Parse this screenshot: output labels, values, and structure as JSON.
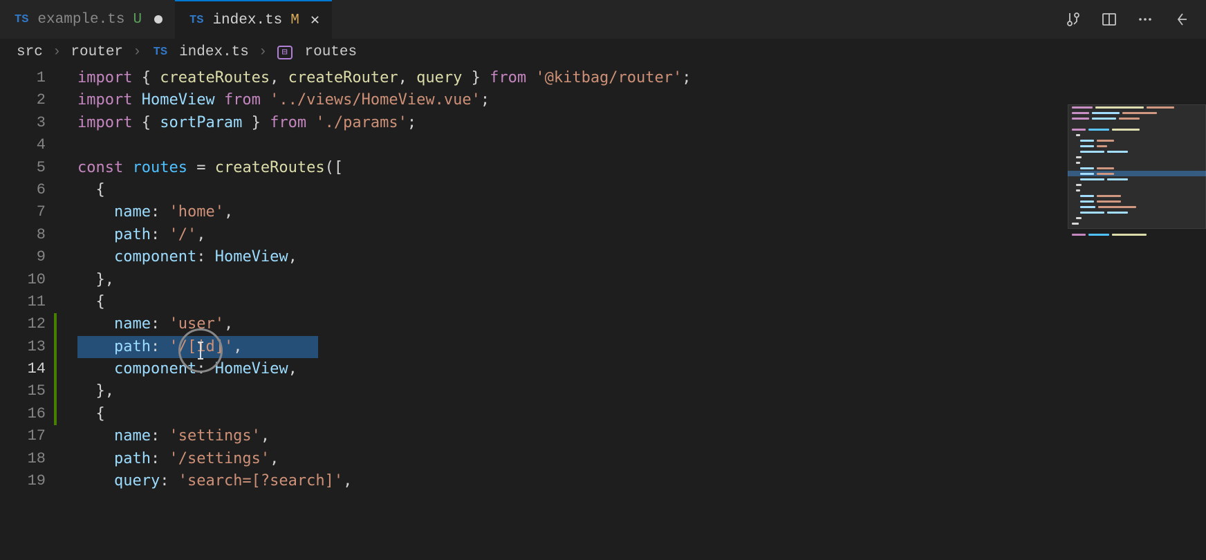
{
  "tabs": [
    {
      "icon": "TS",
      "name": "example.ts",
      "status": "U",
      "dirty": true,
      "active": false
    },
    {
      "icon": "TS",
      "name": "index.ts",
      "status": "M",
      "dirty": false,
      "active": true
    }
  ],
  "breadcrumb": {
    "parts": [
      "src",
      "router"
    ],
    "file_icon": "TS",
    "file": "index.ts",
    "symbol": "routes"
  },
  "lines": [
    "1",
    "2",
    "3",
    "4",
    "5",
    "6",
    "7",
    "8",
    "9",
    "10",
    "11",
    "12",
    "13",
    "14",
    "15",
    "16",
    "17",
    "18",
    "19"
  ],
  "active_line": "14",
  "code": {
    "l1": {
      "t": "import ",
      "a": "{ ",
      "b": "createRoutes",
      "c": ", ",
      "d": "createRouter",
      "e": ", ",
      "f": "query",
      "g": " } ",
      "h": "from ",
      "i": "'@kitbag/router'",
      "j": ";"
    },
    "l2": {
      "t": "import ",
      "a": "HomeView ",
      "h": "from ",
      "i": "'../views/HomeView.vue'",
      "j": ";"
    },
    "l3": {
      "t": "import ",
      "a": "{ ",
      "b": "sortParam",
      "g": " } ",
      "h": "from ",
      "i": "'./params'",
      "j": ";"
    },
    "l4": {
      "t": ""
    },
    "l5": {
      "t": "const ",
      "a": "routes ",
      "b": "= ",
      "c": "createRoutes",
      "d": "(["
    },
    "l6": {
      "t": "  {"
    },
    "l7": {
      "a": "    ",
      "b": "name",
      "c": ": ",
      "d": "'home'",
      "e": ","
    },
    "l8": {
      "a": "    ",
      "b": "path",
      "c": ": ",
      "d": "'/'",
      "e": ","
    },
    "l9": {
      "a": "    ",
      "b": "component",
      "c": ": ",
      "d": "HomeView",
      "e": ","
    },
    "l10": {
      "t": "  },"
    },
    "l11": {
      "t": "  {"
    },
    "l12": {
      "a": "    ",
      "b": "name",
      "c": ": ",
      "d": "'user'",
      "e": ","
    },
    "l13": {
      "a": "    ",
      "b": "path",
      "c": ": ",
      "d": "'/[id]'",
      "e": ","
    },
    "l14": {
      "a": "    ",
      "b": "component",
      "c": ": ",
      "d": "HomeView",
      "e": ","
    },
    "l15": {
      "t": "  },"
    },
    "l16": {
      "t": "  {"
    },
    "l17": {
      "a": "    ",
      "b": "name",
      "c": ": ",
      "d": "'settings'",
      "e": ","
    },
    "l18": {
      "a": "    ",
      "b": "path",
      "c": ": ",
      "d": "'/settings'",
      "e": ","
    },
    "l19": {
      "a": "    ",
      "b": "query",
      "c": ": ",
      "d": "'search=[?search]'",
      "e": ","
    }
  }
}
